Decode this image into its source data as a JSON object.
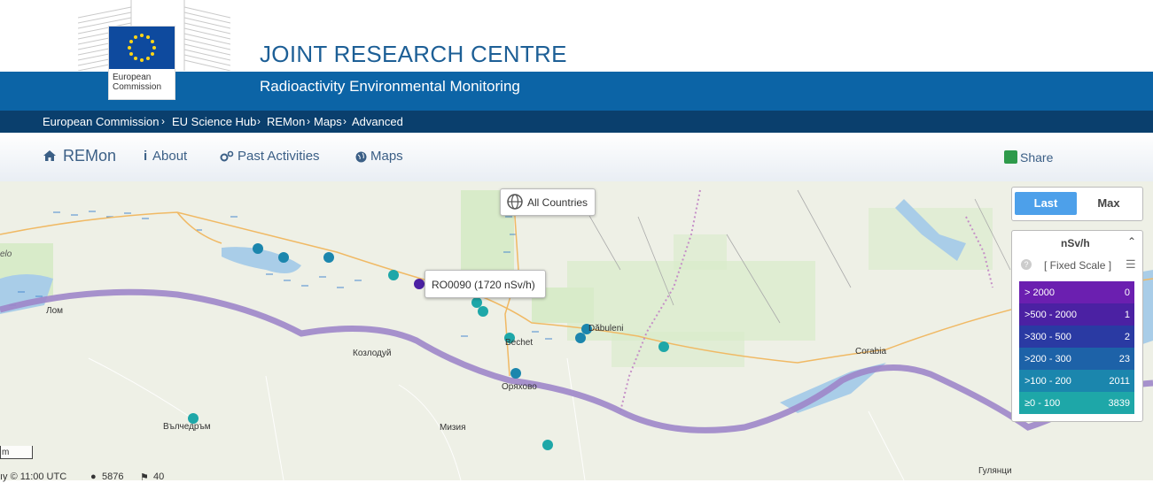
{
  "header": {
    "logo_text_line1": "European",
    "logo_text_line2": "Commission",
    "title": "JOINT RESEARCH CENTRE",
    "subtitle": "Radioactivity Environmental Monitoring"
  },
  "breadcrumb": {
    "items": [
      "European Commission",
      "EU Science Hub",
      "REMon",
      "Maps",
      "Advanced"
    ]
  },
  "nav": {
    "home": "REMon",
    "about": "About",
    "past": "Past Activities",
    "maps": "Maps",
    "share": "Share"
  },
  "map": {
    "all_countries": "All Countries",
    "tooltip": "RO0090 (1720 nSv/h)",
    "places": {
      "lom": "Лом",
      "kozloduy": "Козлодуй",
      "bechet": "Bechet",
      "oryahovo": "Оряхово",
      "dabuleni": "Dăbuleni",
      "corabia": "Corabia",
      "valchedram": "Вълчедръм",
      "miziya": "Мизия",
      "gulyantsi": "Гулянци",
      "elo": "elo"
    },
    "scale_label": "m",
    "status_time": "ıy © 11:00 UTC",
    "status_count1": "5876",
    "status_count2": "40"
  },
  "controls": {
    "last": "Last",
    "max": "Max"
  },
  "legend": {
    "unit": "nSv/h",
    "scale": "[ Fixed Scale ]",
    "rows": [
      {
        "range": "> 2000",
        "count": "0",
        "color": "#6b1fb0"
      },
      {
        "range": ">500 - 2000",
        "count": "1",
        "color": "#4b21a3"
      },
      {
        "range": ">300 - 500",
        "count": "2",
        "color": "#2a3aa3"
      },
      {
        "range": ">200 - 300",
        "count": "23",
        "color": "#1d62a8"
      },
      {
        "range": ">100 - 200",
        "count": "2011",
        "color": "#1b86ad"
      },
      {
        "range": "≥0 - 100",
        "count": "3839",
        "color": "#1ea7a8"
      }
    ]
  },
  "colors": {
    "band": "#0c64a6",
    "crumbs": "#0a3f6d",
    "river": "#9d86c9",
    "station_teal": "#1ea7a8",
    "station_blue": "#1b86ad",
    "station_purple": "#4b21a3"
  }
}
